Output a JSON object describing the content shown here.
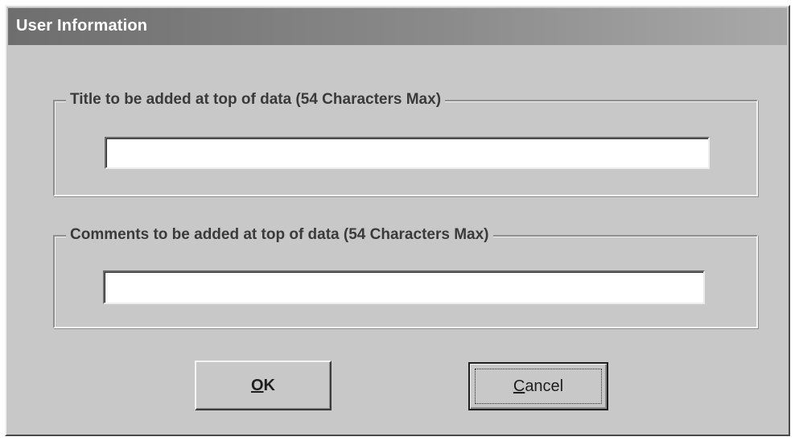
{
  "dialog": {
    "title": "User Information"
  },
  "title_group": {
    "label": "Title to be added at top of data (54 Characters Max)",
    "value": "",
    "placeholder": ""
  },
  "comments_group": {
    "label": "Comments to be added at top of data (54 Characters Max)",
    "value": "",
    "placeholder": ""
  },
  "buttons": {
    "ok": {
      "accel": "O",
      "rest": "K"
    },
    "cancel": {
      "accel": "C",
      "rest": "ancel"
    }
  },
  "colors": {
    "dialog_face": "#c8c8c8",
    "titlebar_start": "#6e6e6e",
    "titlebar_end": "#a9a9a9",
    "field_bg": "#ffffff"
  }
}
